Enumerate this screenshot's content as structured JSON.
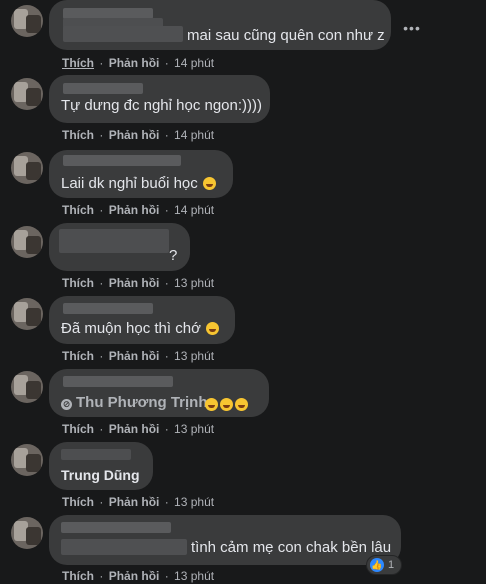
{
  "actions": {
    "like": "Thích",
    "reply": "Phản hồi",
    "separator": "·"
  },
  "comments": [
    {
      "text": "mai sau cũng quên con như z",
      "time": "14 phút",
      "more": "•••"
    },
    {
      "text": "Tự dưng đc nghỉ học ngon:))))",
      "time": "14 phút"
    },
    {
      "text": "Laii dk nghỉ buổi học",
      "emoji": "laughing-emoji",
      "time": "14 phút"
    },
    {
      "text": "?",
      "time": "13 phút"
    },
    {
      "text": "Đã muộn học thì chớ",
      "emoji": "laughing-emoji",
      "time": "13 phút"
    },
    {
      "tag": "Thu Phương Trịnh",
      "emoji": "rofl-emoji",
      "emoji_count": 3,
      "time": "13 phút"
    },
    {
      "name": "Trung Dũng",
      "time": "13 phút"
    },
    {
      "text": "tình cảm mẹ con chak bền lâu",
      "time": "13 phút",
      "reaction_count": "1"
    }
  ],
  "colors": {
    "background": "#18191a",
    "bubble": "#3a3b3c",
    "text": "#e4e6eb",
    "muted": "#b0b3b8",
    "like_blue": "#2d88ff"
  }
}
